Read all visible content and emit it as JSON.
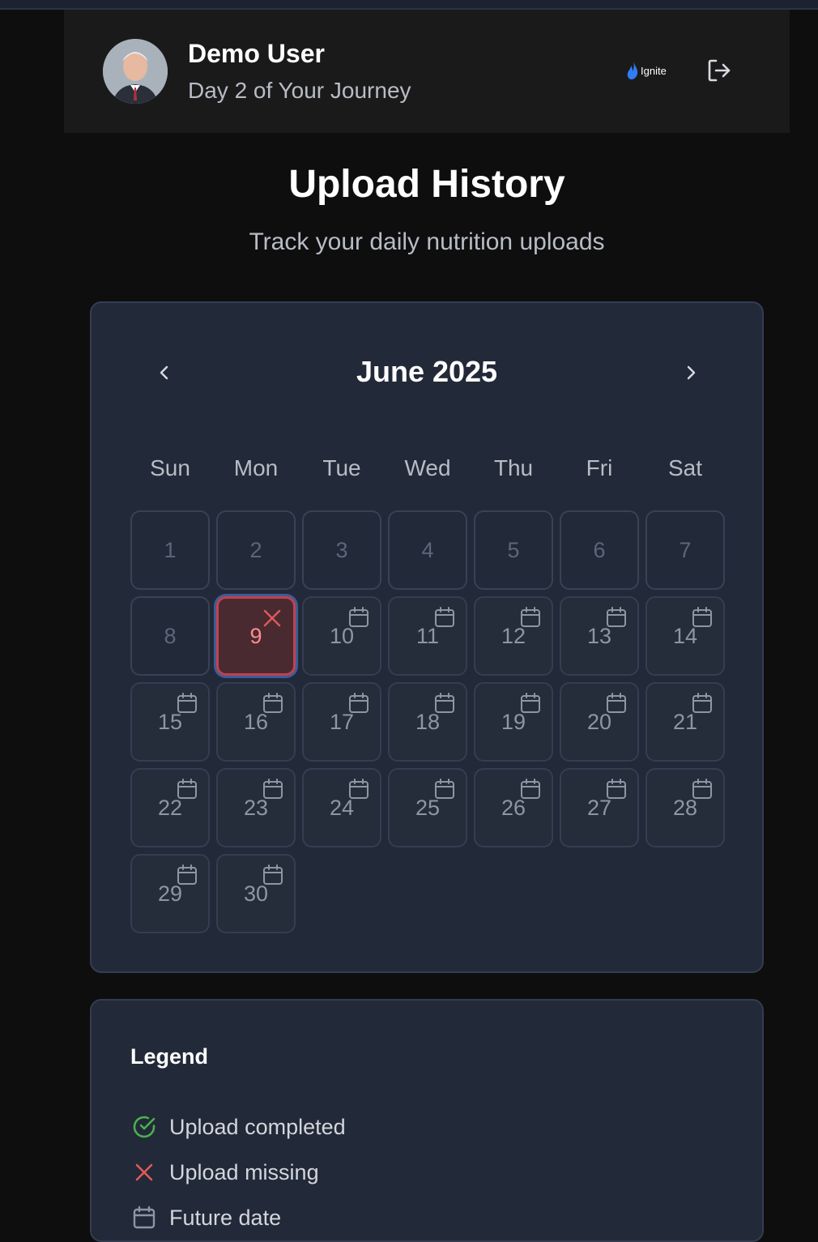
{
  "header": {
    "user_name": "Demo User",
    "journey_text": "Day 2 of Your Journey",
    "brand": "Ignite",
    "icons": {
      "avatar": "avatar",
      "logout": "logout-icon",
      "brand_logo": "flame-icon"
    }
  },
  "page": {
    "title": "Upload History",
    "subtitle": "Track your daily nutrition uploads"
  },
  "calendar": {
    "month_label": "June 2025",
    "prev_icon": "chevron-left-icon",
    "next_icon": "chevron-right-icon",
    "weekdays": [
      "Sun",
      "Mon",
      "Tue",
      "Wed",
      "Thu",
      "Fri",
      "Sat"
    ],
    "first_weekday_index": 0,
    "days": [
      {
        "day": "1",
        "status": "past"
      },
      {
        "day": "2",
        "status": "past"
      },
      {
        "day": "3",
        "status": "past"
      },
      {
        "day": "4",
        "status": "past"
      },
      {
        "day": "5",
        "status": "past"
      },
      {
        "day": "6",
        "status": "past"
      },
      {
        "day": "7",
        "status": "past"
      },
      {
        "day": "8",
        "status": "past"
      },
      {
        "day": "9",
        "status": "missing"
      },
      {
        "day": "10",
        "status": "future"
      },
      {
        "day": "11",
        "status": "future"
      },
      {
        "day": "12",
        "status": "future"
      },
      {
        "day": "13",
        "status": "future"
      },
      {
        "day": "14",
        "status": "future"
      },
      {
        "day": "15",
        "status": "future"
      },
      {
        "day": "16",
        "status": "future"
      },
      {
        "day": "17",
        "status": "future"
      },
      {
        "day": "18",
        "status": "future"
      },
      {
        "day": "19",
        "status": "future"
      },
      {
        "day": "20",
        "status": "future"
      },
      {
        "day": "21",
        "status": "future"
      },
      {
        "day": "22",
        "status": "future"
      },
      {
        "day": "23",
        "status": "future"
      },
      {
        "day": "24",
        "status": "future"
      },
      {
        "day": "25",
        "status": "future"
      },
      {
        "day": "26",
        "status": "future"
      },
      {
        "day": "27",
        "status": "future"
      },
      {
        "day": "28",
        "status": "future"
      },
      {
        "day": "29",
        "status": "future"
      },
      {
        "day": "30",
        "status": "future"
      }
    ]
  },
  "legend": {
    "title": "Legend",
    "items": [
      {
        "label": "Upload completed",
        "icon": "check-circle-icon",
        "color": "#4caf50"
      },
      {
        "label": "Upload missing",
        "icon": "x-icon",
        "color": "#e05a5a"
      },
      {
        "label": "Future date",
        "icon": "calendar-icon",
        "color": "#8e95a3"
      }
    ]
  },
  "colors": {
    "background": "#0e0e0f",
    "card": "#222938",
    "missing": "#e05a5a",
    "completed": "#4caf50",
    "selected_ring": "#3f5b97",
    "brand": "#2f7df6"
  }
}
